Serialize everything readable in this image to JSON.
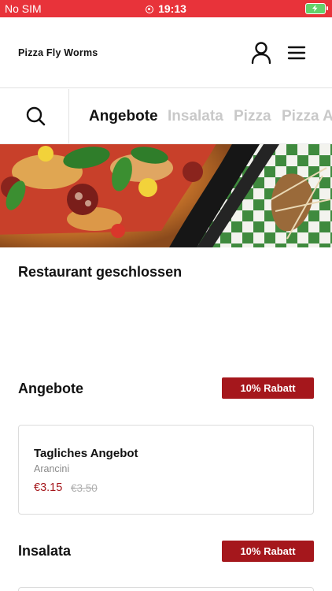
{
  "status_bar": {
    "carrier": "No SIM",
    "time": "19:13"
  },
  "header": {
    "brand": "Pizza Fly Worms"
  },
  "tabs": [
    {
      "label": "Angebote",
      "active": true
    },
    {
      "label": "Insalata",
      "active": false
    },
    {
      "label": "Pizza",
      "active": false
    },
    {
      "label": "Pizza A",
      "active": false
    }
  ],
  "notice": "Restaurant geschlossen",
  "sections": [
    {
      "title": "Angebote",
      "badge": "10% Rabatt",
      "items": [
        {
          "name": "Tagliches Angebot",
          "description": "Arancini",
          "price": "€3.15",
          "old_price": "€3.50"
        }
      ]
    },
    {
      "title": "Insalata",
      "badge": "10% Rabatt",
      "items": []
    }
  ],
  "icons": {
    "user": "user-icon",
    "menu": "hamburger-menu-icon",
    "search": "search-icon",
    "battery": "battery-charging-icon"
  },
  "colors": {
    "status_bar": "#e8333a",
    "accent": "#a5171c"
  }
}
